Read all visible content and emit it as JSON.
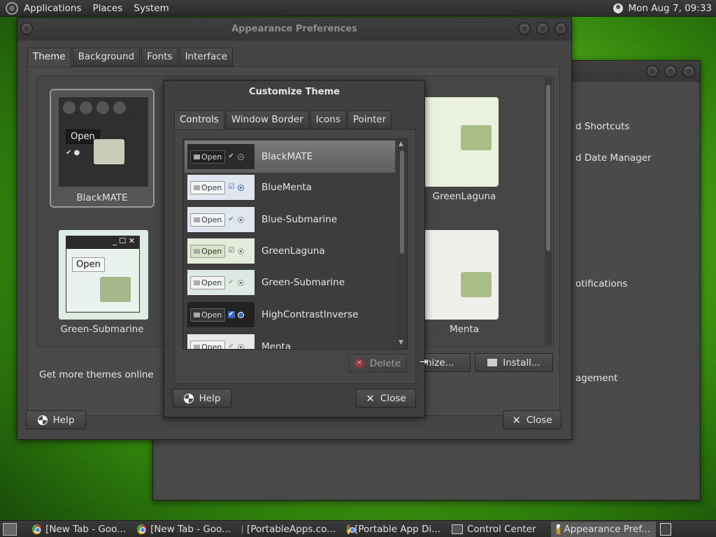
{
  "topbar": {
    "menus": [
      "Applications",
      "Places",
      "System"
    ],
    "clock": "Mon Aug  7, 09:33"
  },
  "appearance": {
    "title": "Appearance Preferences",
    "tabs": [
      "Theme",
      "Background",
      "Fonts",
      "Interface"
    ],
    "themes": [
      "BlackMATE",
      "GreenLaguna",
      "Green-Submarine",
      "Menta"
    ],
    "get_more": "Get more themes online",
    "customize_label": "mize...",
    "install_label": "Install...",
    "help_label": "Help",
    "close_label": "Close"
  },
  "control_center": {
    "items": [
      "d Shortcuts",
      "d Date Manager",
      "otifications",
      "agement"
    ]
  },
  "customize": {
    "title": "Customize Theme",
    "tabs": [
      "Controls",
      "Window Border",
      "Icons",
      "Pointer"
    ],
    "rows": [
      {
        "name": "BlackMATE",
        "open": "Open"
      },
      {
        "name": "BlueMenta",
        "open": "Open"
      },
      {
        "name": "Blue-Submarine",
        "open": "Open"
      },
      {
        "name": "GreenLaguna",
        "open": "Open"
      },
      {
        "name": "Green-Submarine",
        "open": "Open"
      },
      {
        "name": "HighContrastInverse",
        "open": "Open"
      },
      {
        "name": "Menta",
        "open": "Open"
      }
    ],
    "delete_label": "Delete",
    "help_label": "Help",
    "close_label": "Close"
  },
  "thumb_open": "Open",
  "taskbar": {
    "items": [
      "[New Tab - Goo...",
      "[New Tab - Goo...",
      "[PortableApps.co...",
      "[Portable App Di...",
      "Control Center",
      "Appearance Pref..."
    ]
  },
  "colors": {
    "selected_row": "#6e6e6e",
    "desktop_green": "#5fbe1c",
    "window_bg": "#454545"
  }
}
